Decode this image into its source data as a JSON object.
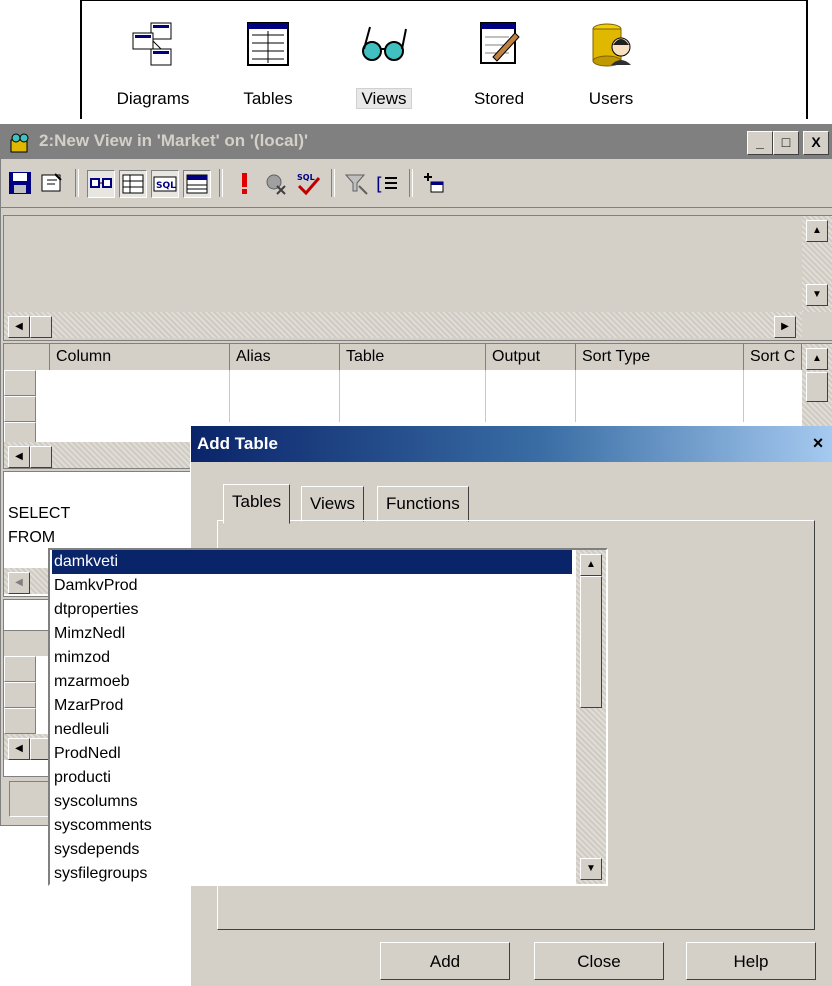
{
  "top_toolbar": {
    "buttons": [
      {
        "label": "Diagrams",
        "icon": "diagrams-icon"
      },
      {
        "label": "Tables",
        "icon": "tables-icon"
      },
      {
        "label": "Views",
        "icon": "views-icon",
        "selected": true
      },
      {
        "label": "Stored",
        "icon": "stored-procedures-icon"
      },
      {
        "label": "Users",
        "icon": "users-icon"
      }
    ]
  },
  "view_window": {
    "title": "2:New View in 'Market' on '(local)'",
    "min_label": "_",
    "max_label": "□",
    "close_label": "X",
    "grid_columns": [
      "Column",
      "Alias",
      "Table",
      "Output",
      "Sort Type",
      "Sort C"
    ],
    "sql_lines": [
      "SELECT",
      "FROM"
    ]
  },
  "dialog": {
    "title": "Add Table",
    "close_label": "×",
    "tabs": [
      "Tables",
      "Views",
      "Functions"
    ],
    "active_tab": "Tables",
    "items": [
      "damkveti",
      "DamkvProd",
      "dtproperties",
      "MimzNedl",
      "mimzod",
      "mzarmoeb",
      "MzarProd",
      "nedleuli",
      "ProdNedl",
      "producti",
      "syscolumns",
      "syscomments",
      "sysdepends",
      "sysfilegroups"
    ],
    "selected_item": "damkveti",
    "buttons": {
      "add": "Add",
      "close": "Close",
      "help": "Help"
    }
  },
  "colors": {
    "title_active": "#0a246a",
    "title_inactive": "#808080",
    "face": "#d4d0c8",
    "selection": "#0a246a"
  }
}
